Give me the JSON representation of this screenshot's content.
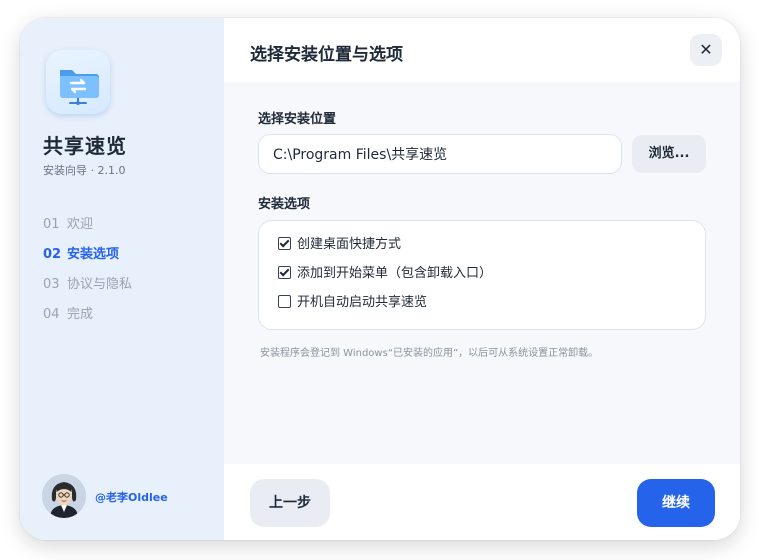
{
  "app": {
    "title": "共享速览",
    "subtitle": "安装向导 · 2.1.0"
  },
  "steps": [
    {
      "num": "01",
      "label": "欢迎",
      "active": false
    },
    {
      "num": "02",
      "label": "安装选项",
      "active": true
    },
    {
      "num": "03",
      "label": "协议与隐私",
      "active": false
    },
    {
      "num": "04",
      "label": "完成",
      "active": false
    }
  ],
  "author": "@老李Oldlee",
  "header": {
    "title": "选择安装位置与选项",
    "close_glyph": "✕"
  },
  "install_location": {
    "label": "选择安装位置",
    "path_value": "C:\\Program Files\\共享速览",
    "browse_label": "浏览..."
  },
  "install_options": {
    "label": "安装选项",
    "items": [
      {
        "label": "创建桌面快捷方式",
        "checked": true
      },
      {
        "label": "添加到开始菜单（包含卸载入口）",
        "checked": true
      },
      {
        "label": "开机自动启动共享速览",
        "checked": false
      }
    ]
  },
  "note": "安装程序会登记到 Windows“已安装的应用”，以后可从系统设置正常卸载。",
  "footer": {
    "prev_label": "上一步",
    "next_label": "继续"
  },
  "colors": {
    "accent": "#2563eb",
    "sidebar_bg": "#e8f0fb",
    "main_bg": "#f6f8fc"
  },
  "icons": {
    "app": "shared-folder-icon",
    "close": "close-icon",
    "avatar": "user-avatar"
  }
}
